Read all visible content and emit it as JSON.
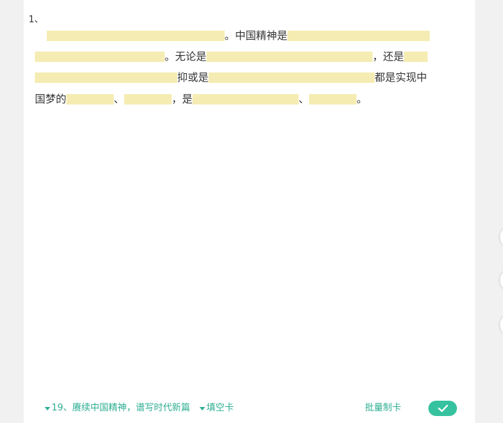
{
  "question": {
    "number": "1、",
    "text": {
      "zhongguo_jingshen_shi": "。中国精神是",
      "wulunshi": "。无论是",
      "haishi": "，还是",
      "huoshi": "抑或是",
      "doushi": "都是实现中",
      "guomeng_de": "国梦的",
      "dun1": "、",
      "shi": "，是",
      "dun2": "、",
      "end": "。"
    }
  },
  "footer": {
    "chapter_label": "19、赓续中国精神，谱写时代新篇",
    "type_label": "填空卡",
    "batch_label": "批量制卡"
  },
  "colors": {
    "blank_highlight": "#f5ecb3",
    "accent_green": "#2fae93",
    "confirm_button": "#36c29f"
  },
  "icons": {
    "confirm": "check-icon",
    "dropdown": "triangle-down-icon"
  }
}
